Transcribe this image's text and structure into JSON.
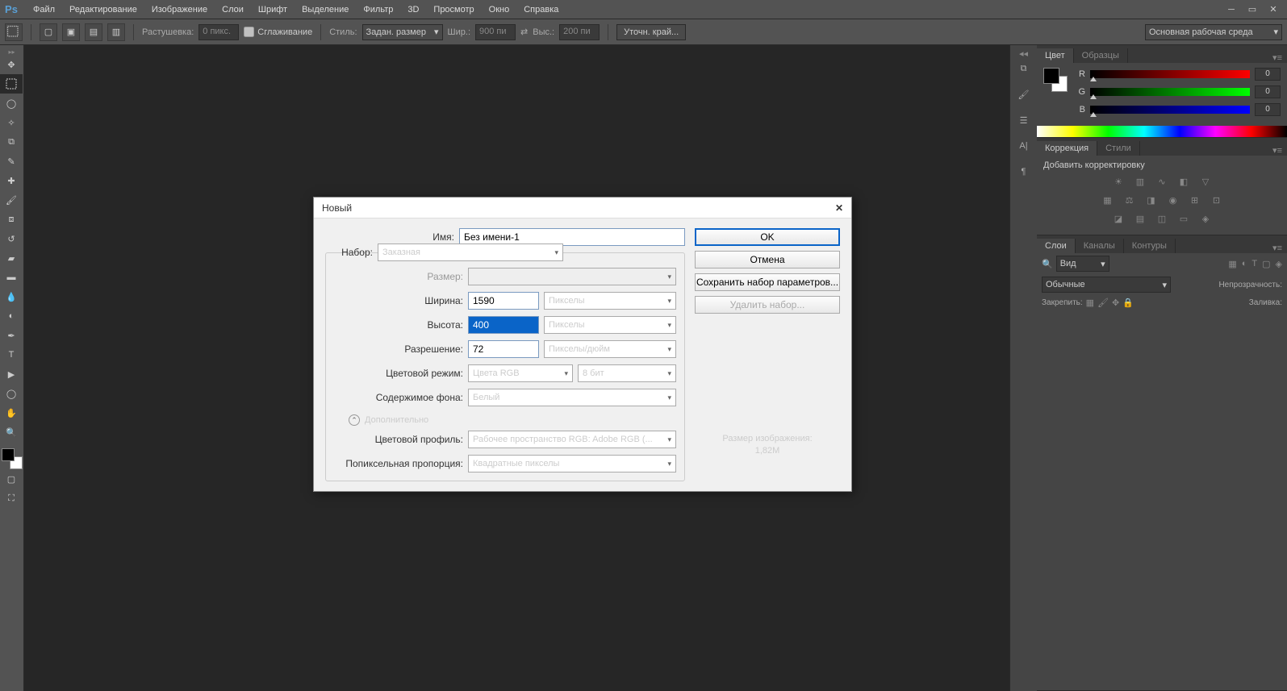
{
  "menubar": {
    "items": [
      "Файл",
      "Редактирование",
      "Изображение",
      "Слои",
      "Шрифт",
      "Выделение",
      "Фильтр",
      "3D",
      "Просмотр",
      "Окно",
      "Справка"
    ]
  },
  "optbar": {
    "feather_lbl": "Растушевка:",
    "feather_val": "0 пикс.",
    "antialias": "Сглаживание",
    "style_lbl": "Стиль:",
    "style_val": "Задан. размер",
    "width_lbl": "Шир.:",
    "width_val": "900 пи",
    "height_lbl": "Выс.:",
    "height_val": "200 пи",
    "refine": "Уточн. край...",
    "workspace": "Основная рабочая среда"
  },
  "panels": {
    "color_tab": "Цвет",
    "swatches_tab": "Образцы",
    "rgb": {
      "r": "0",
      "g": "0",
      "b": "0"
    },
    "adjustments_tab": "Коррекция",
    "styles_tab": "Стили",
    "add_adj": "Добавить корректировку",
    "layers_tab": "Слои",
    "channels_tab": "Каналы",
    "paths_tab": "Контуры",
    "kind": "Вид",
    "blend": "Обычные",
    "opacity_lbl": "Непрозрачность:",
    "lock_lbl": "Закрепить:",
    "fill_lbl": "Заливка:"
  },
  "dialog": {
    "title": "Новый",
    "name_lbl": "Имя:",
    "name_val": "Без имени-1",
    "preset_lbl": "Набор:",
    "preset_val": "Заказная",
    "size_lbl": "Размер:",
    "width_lbl": "Ширина:",
    "width_val": "1590",
    "width_unit": "Пикселы",
    "height_lbl": "Высота:",
    "height_val": "400",
    "height_unit": "Пикселы",
    "res_lbl": "Разрешение:",
    "res_val": "72",
    "res_unit": "Пикселы/дюйм",
    "mode_lbl": "Цветовой режим:",
    "mode_val": "Цвета RGB",
    "depth_val": "8 бит",
    "bg_lbl": "Содержимое фона:",
    "bg_val": "Белый",
    "advanced": "Дополнительно",
    "profile_lbl": "Цветовой профиль:",
    "profile_val": "Рабочее пространство RGB:  Adobe RGB (...",
    "aspect_lbl": "Попиксельная пропорция:",
    "aspect_val": "Квадратные пикселы",
    "ok": "OK",
    "cancel": "Отмена",
    "save_preset": "Сохранить набор параметров...",
    "delete_preset": "Удалить набор...",
    "size_title": "Размер изображения:",
    "size_val": "1,82M"
  }
}
